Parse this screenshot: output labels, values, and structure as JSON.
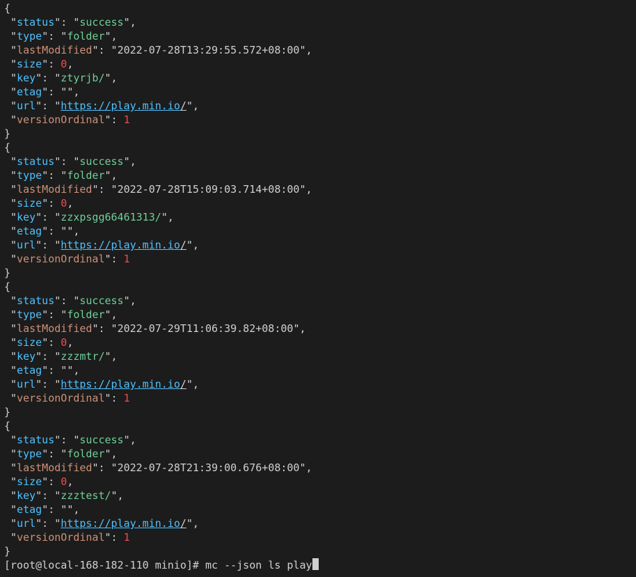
{
  "records": [
    {
      "status": "success",
      "type": "folder",
      "lastModified": "2022-07-28T13:29:55.572+08:00",
      "size": 0,
      "key": "ztyrjb/",
      "etag": "",
      "url_host": "https://play.min.io",
      "url_path": "/",
      "versionOrdinal": 1
    },
    {
      "status": "success",
      "type": "folder",
      "lastModified": "2022-07-28T15:09:03.714+08:00",
      "size": 0,
      "key": "zzxpsgg66461313/",
      "etag": "",
      "url_host": "https://play.min.io",
      "url_path": "/",
      "versionOrdinal": 1
    },
    {
      "status": "success",
      "type": "folder",
      "lastModified": "2022-07-29T11:06:39.82+08:00",
      "size": 0,
      "key": "zzzmtr/",
      "etag": "",
      "url_host": "https://play.min.io",
      "url_path": "/",
      "versionOrdinal": 1
    },
    {
      "status": "success",
      "type": "folder",
      "lastModified": "2022-07-28T21:39:00.676+08:00",
      "size": 0,
      "key": "zzztest/",
      "etag": "",
      "url_host": "https://play.min.io",
      "url_path": "/",
      "versionOrdinal": 1
    }
  ],
  "prompt": {
    "user_host": "[root@local-168-182-110 minio]#",
    "cmd": "mc",
    "flag": "--json",
    "args": "ls play"
  },
  "labels": {
    "status": "status",
    "type": "type",
    "lastModified": "lastModified",
    "size": "size",
    "key": "key",
    "etag": "etag",
    "url": "url",
    "versionOrdinal": "versionOrdinal"
  }
}
